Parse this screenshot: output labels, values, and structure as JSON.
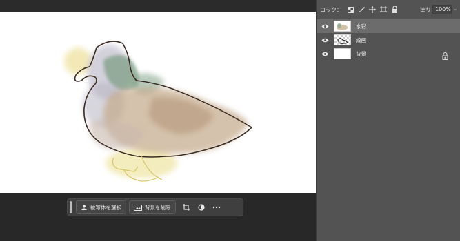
{
  "canvas": {
    "background": "#ffffff"
  },
  "contextual_taskbar": {
    "select_subject_label": "被写体を選択",
    "remove_background_label": "背景を削除",
    "icons": [
      "transform-icon",
      "adjustment-icon",
      "more-icon"
    ]
  },
  "layers_panel": {
    "lock_label": "ロック：",
    "lock_icons": [
      "lock-transparent-pixels-icon",
      "lock-image-pixels-icon",
      "lock-position-icon",
      "lock-artboard-icon",
      "lock-all-icon"
    ],
    "fill_label": "塗り：",
    "fill_value": "100%",
    "layers": [
      {
        "name": "水彩",
        "visible": true,
        "selected": true,
        "thumbnail": "watercolor"
      },
      {
        "name": "線画",
        "visible": true,
        "selected": false,
        "thumbnail": "line-art"
      },
      {
        "name": "背景",
        "visible": true,
        "selected": false,
        "thumbnail": "white",
        "locked": true
      }
    ]
  },
  "colors": {
    "workspace": "#282828",
    "panel": "#535353",
    "selected_layer": "#6c6c6c",
    "taskbar": "#3f3f3f"
  }
}
